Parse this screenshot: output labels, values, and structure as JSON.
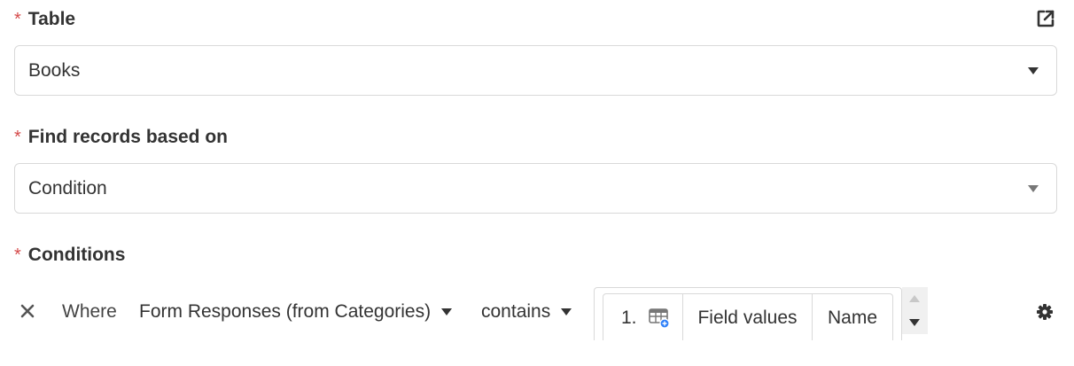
{
  "table_section": {
    "required_mark": "*",
    "label": "Table",
    "value": "Books",
    "open_icon": "external-link-icon"
  },
  "find_section": {
    "required_mark": "*",
    "label": "Find records based on",
    "value": "Condition"
  },
  "conditions_section": {
    "required_mark": "*",
    "label": "Conditions",
    "row": {
      "remove_icon": "close-icon",
      "where_label": "Where",
      "field": "Form Responses (from Categories)",
      "operator": "contains",
      "value_token": {
        "step": "1.",
        "icon": "table-add-icon",
        "source": "Field values",
        "field": "Name"
      },
      "settings_icon": "gear-icon"
    }
  },
  "colors": {
    "required": "#d54b4b",
    "border": "#d9d9d9",
    "text": "#333333",
    "icon_accent": "#2d7ff9"
  }
}
